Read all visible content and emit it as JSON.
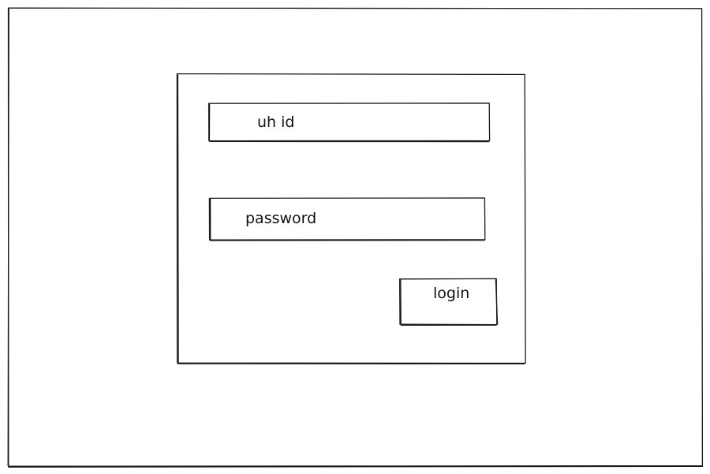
{
  "login_form": {
    "id_field": {
      "placeholder": "uh id"
    },
    "password_field": {
      "placeholder": "password"
    },
    "login_button": {
      "label": "login"
    }
  },
  "colors": {
    "stroke": "#1a1a1a",
    "background": "#ffffff"
  }
}
